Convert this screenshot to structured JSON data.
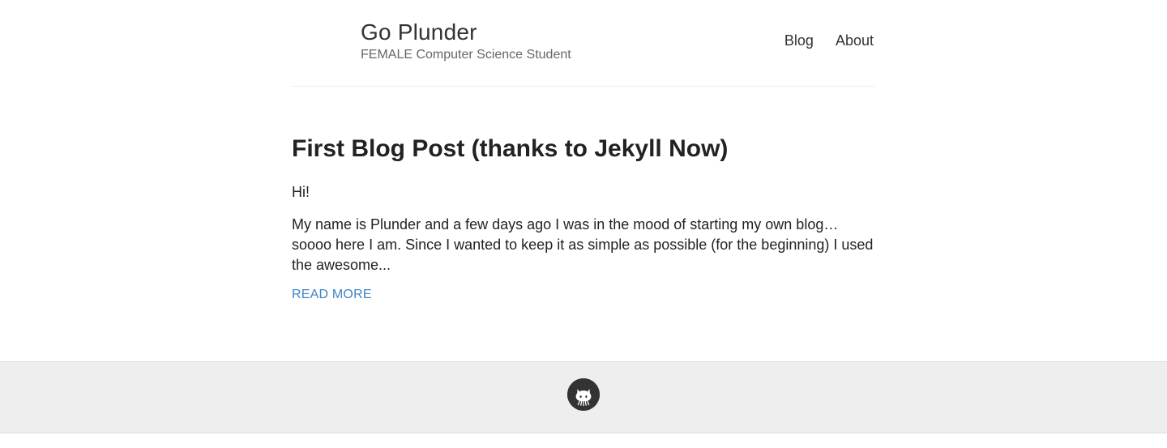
{
  "header": {
    "site_name": "Go Plunder",
    "site_description": "FEMALE Computer Science Student",
    "nav": [
      {
        "label": "Blog"
      },
      {
        "label": "About"
      }
    ]
  },
  "post": {
    "title": "First Blog Post (thanks to Jekyll Now)",
    "paragraphs": [
      "Hi!",
      "My name is Plunder and a few days ago I was in the mood of starting my own blog… soooo here I am. Since I wanted to keep it as simple as possible (for the beginning) I used the awesome..."
    ],
    "read_more": "READ MORE"
  },
  "footer": {
    "icon": "github-icon"
  },
  "colors": {
    "link": "#4183c4",
    "footer_bg": "#eeeeee",
    "text": "#222222"
  }
}
